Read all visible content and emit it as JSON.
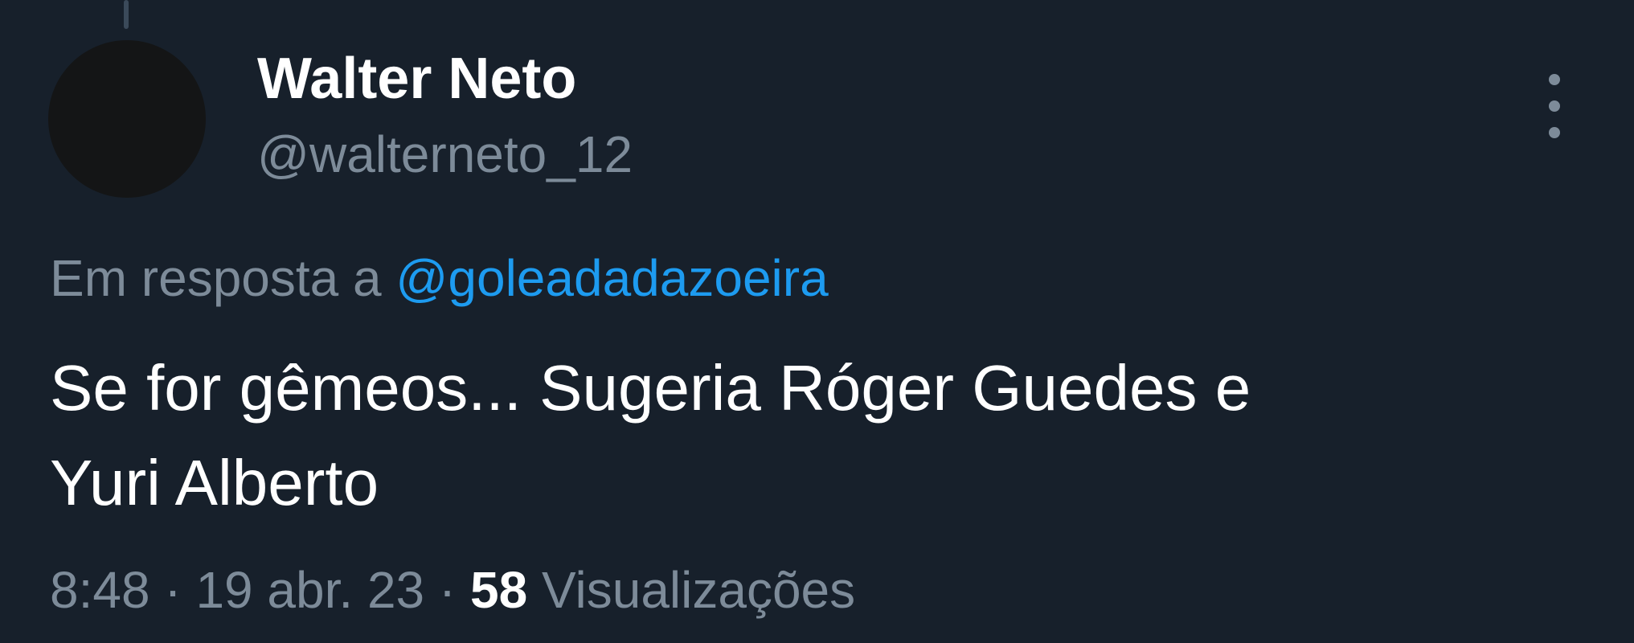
{
  "tweet": {
    "author": {
      "display_name": "Walter Neto",
      "handle": "@walterneto_12"
    },
    "reply_context": {
      "prefix": "Em resposta a",
      "mention": "@goleadadazoeira"
    },
    "text_lines": [
      "Se for gêmeos... Sugeria Róger Guedes e",
      "Yuri Alberto"
    ],
    "meta": {
      "time": "8:48",
      "separator": "·",
      "date": "19 abr. 23",
      "views_count": "58",
      "views_label": "Visualizações"
    }
  },
  "icons": {
    "more": "more-vertical-icon"
  },
  "colors": {
    "background": "#17202b",
    "primary_text": "#ffffff",
    "secondary_text": "#7d8b99",
    "link": "#1d9bf0"
  }
}
